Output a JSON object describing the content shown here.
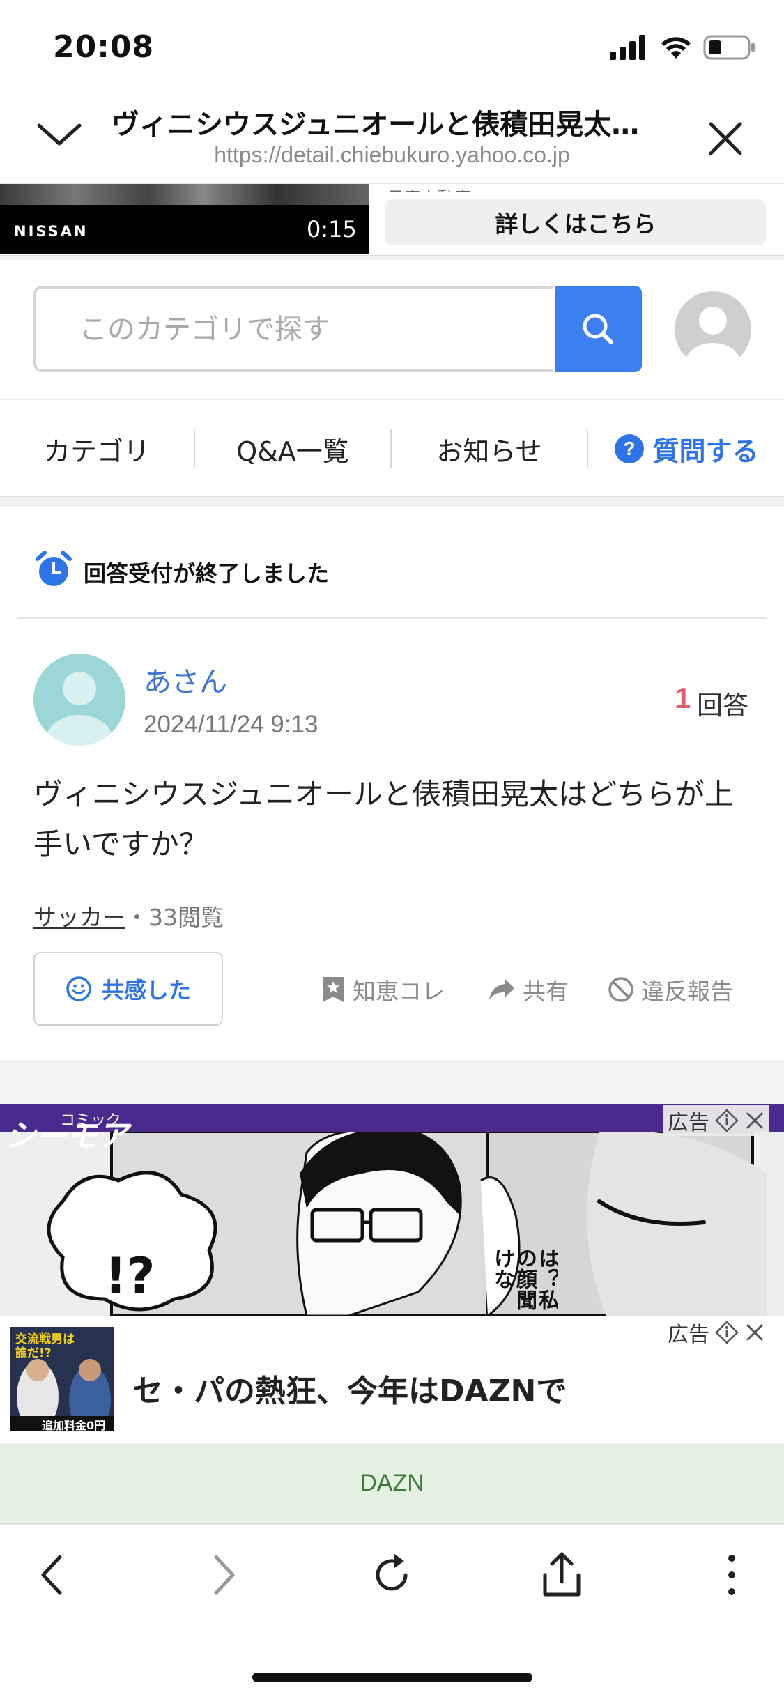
{
  "status_bar": {
    "time": "20:08"
  },
  "browser": {
    "title": "ヴィニシウスジュニオールと俵積田晃太…",
    "url": "https://detail.chiebukuro.yahoo.co.jp"
  },
  "top_ad": {
    "brand": "NISSAN",
    "duration": "0:15",
    "sub": "日産自動車",
    "cta": "詳しくはこちら"
  },
  "search": {
    "placeholder": "このカテゴリで探す"
  },
  "nav": {
    "items": [
      "カテゴリ",
      "Q&A一覧",
      "お知らせ"
    ],
    "ask": "質問する"
  },
  "closed_notice": "回答受付が終了しました",
  "question": {
    "user": "あさん",
    "date": "2024/11/24 9:13",
    "answer_count": "1",
    "answer_label": "回答",
    "text": "ヴィニシウスジュニオールと俵積田晃太はどちらが上手いですか？",
    "category": "サッカー",
    "views": "・33閲覧"
  },
  "actions": {
    "empathy": "共感した",
    "collect": "知恵コレ",
    "share": "共有",
    "report": "違反報告"
  },
  "comic_ad": {
    "logo": "シーモア",
    "logo_sub": "コミック",
    "badge": "広告",
    "bubble": "!?",
    "vertical_text": "は？私の顔聞けな"
  },
  "dazn_ad": {
    "badge": "広告",
    "thumb_head": "交流戦男は誰だ!?",
    "thumb_foot": "追加料金0円",
    "headline": "セ・パの熱狂、今年はDAZNで",
    "sponsor": "DAZN"
  },
  "colors": {
    "accent": "#3b7ff2",
    "link": "#2e74e8",
    "count": "#e45c6a"
  }
}
